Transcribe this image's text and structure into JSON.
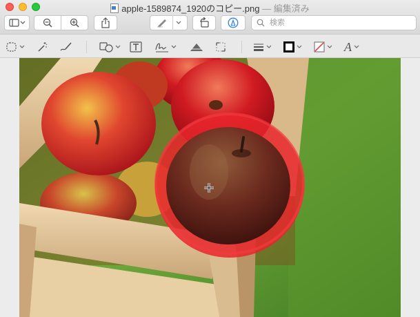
{
  "window": {
    "filename": "apple-1589874_1920のコピー.png",
    "separator": "—",
    "status": "編集済み"
  },
  "toolbar": {
    "buttons": [
      {
        "name": "sidebar-toggle",
        "icon": "sidebar-icon"
      },
      {
        "name": "zoom-out",
        "icon": "zoom-out-icon"
      },
      {
        "name": "zoom-in",
        "icon": "zoom-in-icon"
      },
      {
        "name": "share",
        "icon": "share-icon"
      },
      {
        "name": "markup-pen",
        "icon": "pen-icon"
      },
      {
        "name": "rotate",
        "icon": "rotate-icon"
      },
      {
        "name": "markup-toggle",
        "icon": "markup-icon"
      }
    ],
    "search": {
      "placeholder": "検索",
      "value": ""
    }
  },
  "markup_toolbar": {
    "tools": [
      "selection-tool",
      "instant-alpha",
      "sketch",
      "shapes",
      "text",
      "sign",
      "adjust-color",
      "adjust-size",
      "shape-style",
      "border-color",
      "fill-color",
      "text-style"
    ],
    "text_style_glyph": "A",
    "border_color": "#000000",
    "fill_color": "none",
    "annotation_color": "#e8262b"
  }
}
